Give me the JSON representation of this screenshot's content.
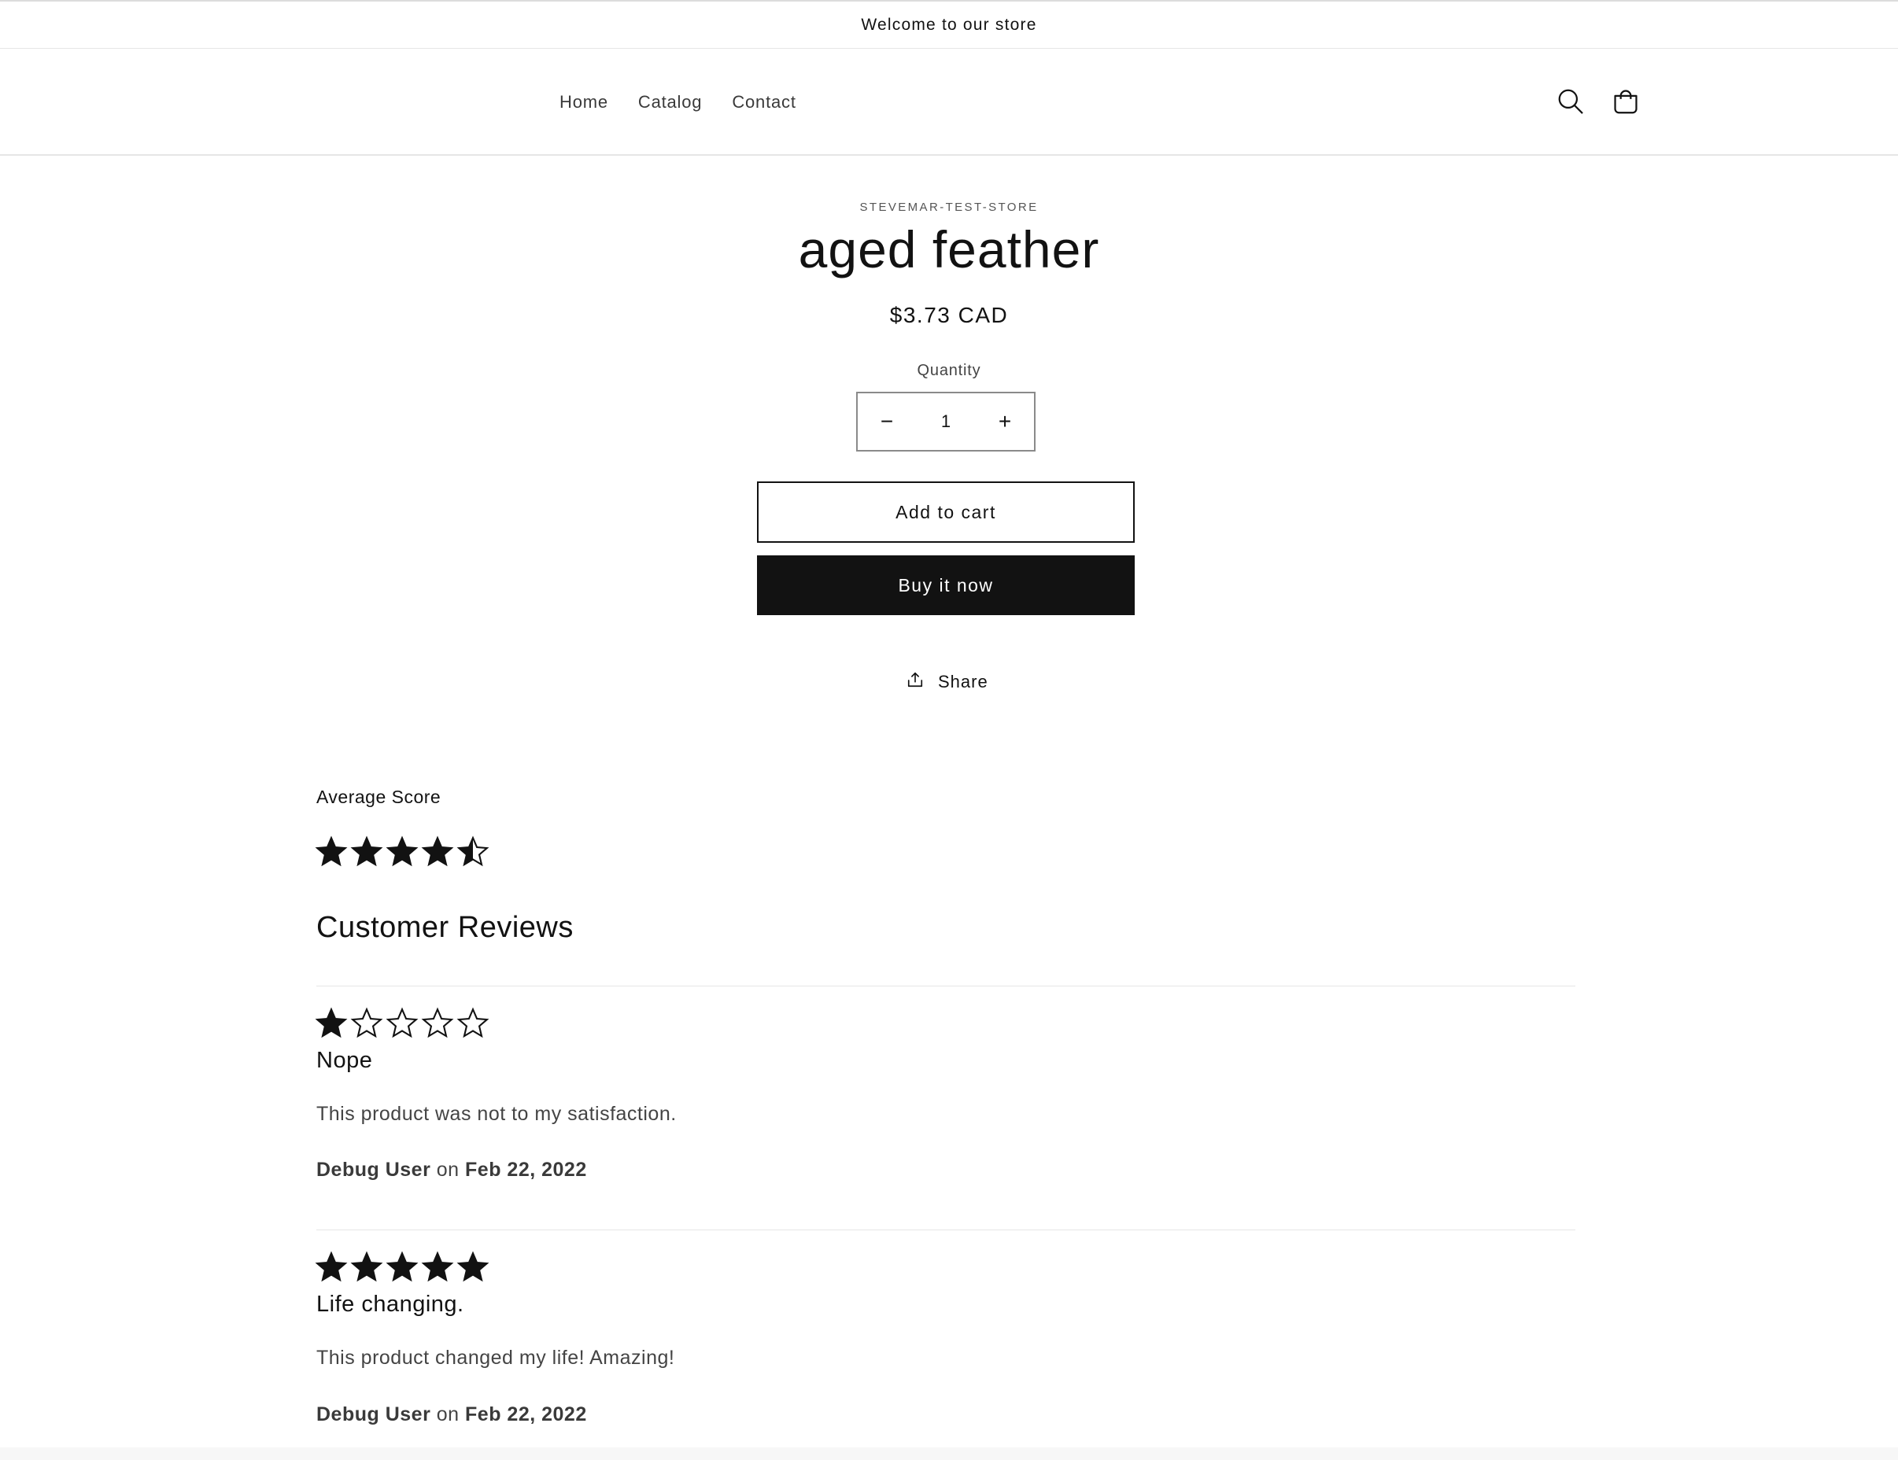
{
  "announcement": "Welcome to our store",
  "nav": {
    "home": "Home",
    "catalog": "Catalog",
    "contact": "Contact"
  },
  "header_icons": [
    "search-icon",
    "cart-icon"
  ],
  "product": {
    "vendor": "STEVEMAR-TEST-STORE",
    "title": "aged feather",
    "price": "$3.73 CAD",
    "quantity_label": "Quantity",
    "quantity_value": "1",
    "decrease": "−",
    "increase": "+",
    "add_to_cart": "Add to cart",
    "buy_now": "Buy it now",
    "share": "Share"
  },
  "reviews": {
    "average_label": "Average Score",
    "average_rating": 4.5,
    "heading": "Customer Reviews",
    "items": [
      {
        "rating": 1,
        "title": "Nope",
        "body": "This product was not to my satisfaction.",
        "author": "Debug User",
        "on": "on",
        "date": "Feb 22, 2022"
      },
      {
        "rating": 5,
        "title": "Life changing.",
        "body": "This product changed my life! Amazing!",
        "author": "Debug User",
        "on": "on",
        "date": "Feb 22, 2022"
      }
    ]
  },
  "colors": {
    "text": "#121212",
    "button_dark": "#121212",
    "border": "#e6e6e6"
  }
}
